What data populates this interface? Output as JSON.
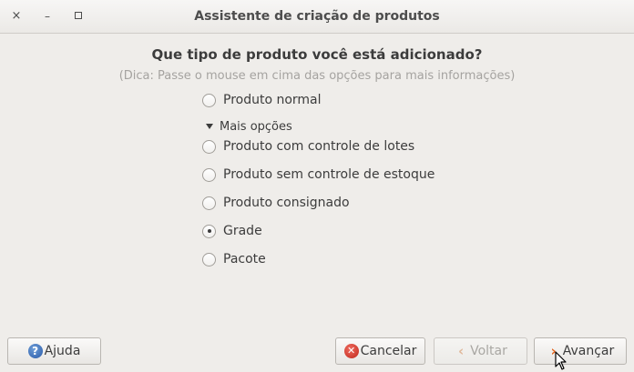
{
  "window": {
    "title": "Assistente de criação de produtos",
    "close_glyph": "×",
    "minimize_glyph": "–"
  },
  "question": "Que tipo de produto você está adicionado?",
  "hint": "(Dica: Passe o mouse em cima das opções para mais informações)",
  "options": [
    {
      "label": "Produto normal",
      "checked": false
    },
    {
      "label": "Produto com controle de lotes",
      "checked": false
    },
    {
      "label": "Produto sem controle de estoque",
      "checked": false
    },
    {
      "label": "Produto consignado",
      "checked": false
    },
    {
      "label": "Grade",
      "checked": true
    },
    {
      "label": "Pacote",
      "checked": false
    }
  ],
  "expander": {
    "label": "Mais opções",
    "expanded": true
  },
  "buttons": {
    "help": {
      "label": "Ajuda",
      "icon": "help-icon"
    },
    "cancel": {
      "label": "Cancelar",
      "icon": "cancel-icon"
    },
    "back": {
      "label": "Voltar",
      "icon": "back-arrow-icon",
      "disabled": true
    },
    "forward": {
      "label": "Avançar",
      "icon": "forward-arrow-icon"
    }
  },
  "colors": {
    "background": "#efedea",
    "hint_text": "#a5a3a0",
    "cancel_icon": "#c0281c",
    "help_icon": "#2a5aa8",
    "forward_icon": "#e4651e"
  }
}
